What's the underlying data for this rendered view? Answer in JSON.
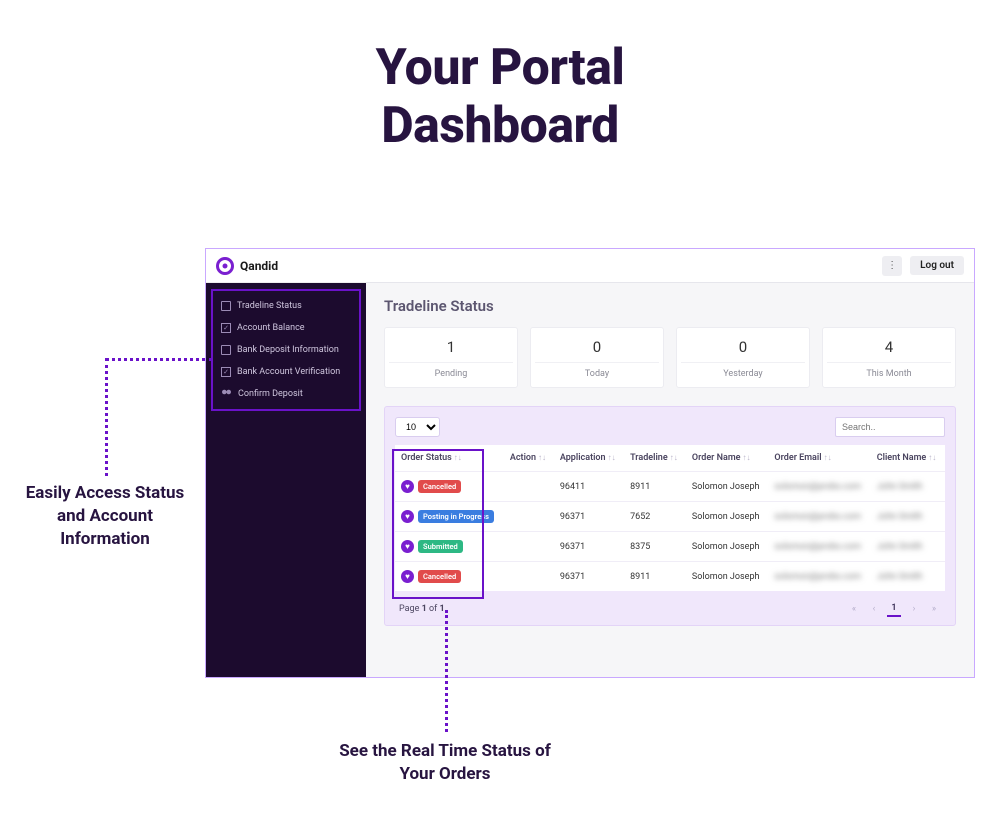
{
  "hero": {
    "line1": "Your Portal",
    "line2": "Dashboard"
  },
  "brand": {
    "name": "Qandid"
  },
  "topbar": {
    "logout": "Log out"
  },
  "sidebar": {
    "items": [
      {
        "label": "Tradeline Status"
      },
      {
        "label": "Account Balance"
      },
      {
        "label": "Bank Deposit Information"
      },
      {
        "label": "Bank Account Verification"
      },
      {
        "label": "Confirm Deposit"
      }
    ]
  },
  "page": {
    "heading": "Tradeline Status"
  },
  "stats": [
    {
      "value": "1",
      "label": "Pending"
    },
    {
      "value": "0",
      "label": "Today"
    },
    {
      "value": "0",
      "label": "Yesterday"
    },
    {
      "value": "4",
      "label": "This Month"
    }
  ],
  "table": {
    "per_page": "10",
    "search_placeholder": "Search..",
    "columns": {
      "status": "Order Status",
      "action": "Action",
      "application": "Application",
      "tradeline": "Tradeline",
      "order_name": "Order Name",
      "order_email": "Order Email",
      "client_name": "Client Name"
    },
    "rows": [
      {
        "status": "Cancelled",
        "status_color": "red",
        "application": "96411",
        "tradeline": "8911",
        "order_name": "Solomon Joseph",
        "order_email": "solomon@probo.com",
        "client_name": "John Smith"
      },
      {
        "status": "Posting in Progress",
        "status_color": "blue",
        "application": "96371",
        "tradeline": "7652",
        "order_name": "Solomon Joseph",
        "order_email": "solomon@probo.com",
        "client_name": "John Smith"
      },
      {
        "status": "Submitted",
        "status_color": "green",
        "application": "96371",
        "tradeline": "8375",
        "order_name": "Solomon Joseph",
        "order_email": "solomon@probo.com",
        "client_name": "John Smith"
      },
      {
        "status": "Cancelled",
        "status_color": "red",
        "application": "96371",
        "tradeline": "8911",
        "order_name": "Solomon Joseph",
        "order_email": "solomon@probo.com",
        "client_name": "John Smith"
      }
    ],
    "page_info_prefix": "Page ",
    "page_info_bold": "1",
    "page_info_mid": " of ",
    "page_info_total": "1",
    "current_page": "1"
  },
  "callouts": {
    "left": "Easily Access Status and Account Information",
    "bottom": "See the Real Time Status of Your Orders"
  }
}
